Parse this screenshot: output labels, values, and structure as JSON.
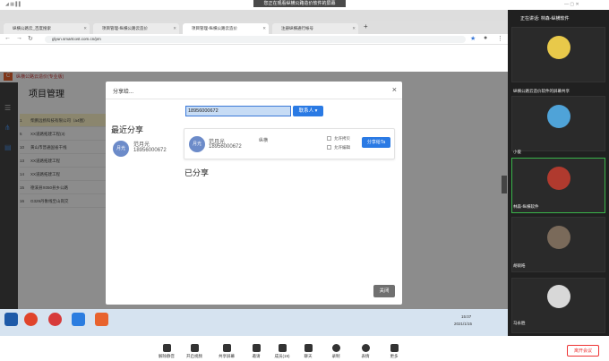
{
  "banner": {
    "text": "您正在观看纵横公路造价软件的屏幕"
  },
  "browser": {
    "tabs": [
      {
        "label": "纵横公路云_百度搜索"
      },
      {
        "label": "项目管理-纵横公路云造价"
      },
      {
        "label": "项目管理-纵横公路云造价"
      },
      {
        "label": "注册纵横通行帐号"
      }
    ],
    "url": "glyun.smartcost.com.cn/pm"
  },
  "app": {
    "brand": "纵横公路云造价(专业版)",
    "title": "项目管理",
    "rows": [
      {
        "num": "1",
        "name": "柴鹏远扬科技有限公司（a4图）"
      },
      {
        "num": "5",
        "name": "XX道路拓建工程(3)"
      },
      {
        "num": "10",
        "name": "黄山市普通国省干线"
      },
      {
        "num": "13",
        "name": "XX道路拓建工程"
      },
      {
        "num": "14",
        "name": "XX道路拓建工程"
      },
      {
        "num": "15",
        "name": "德溪县X050县乡公路"
      },
      {
        "num": "16",
        "name": "G329丹象线至山岗交"
      }
    ]
  },
  "modal": {
    "title": "分享给...",
    "search_value": "18956000672",
    "contact_label": "联系人",
    "recent_title": "最近分享",
    "recent_avatar": "月光",
    "recent_name": "范月光",
    "recent_phone": "18956000672",
    "card_avatar": "月光",
    "card_name": "范月光",
    "card_phone": "18956000672",
    "card_company": "纵横",
    "allow_copy": "允许拷贝",
    "allow_edit": "允许编辑",
    "share_to": "分享给Ta",
    "shared_title": "已分享",
    "close": "关闭"
  },
  "taskbar": {
    "time": "15:07",
    "date": "2021/1/15"
  },
  "right_panel": {
    "speaking": "正在讲话: 林森-纵横软件",
    "tiles": [
      {
        "caption": "纵横公路云造价软件的屏幕共享"
      },
      {
        "caption": "小俊"
      },
      {
        "caption": "林森-纵横软件"
      },
      {
        "caption": "胡硕皓"
      },
      {
        "caption": "马永胜"
      }
    ]
  },
  "bottom_bar": {
    "tools": [
      "解除静音",
      "开启视频",
      "共享屏幕",
      "邀请",
      "成员(19)",
      "聊天",
      "录制",
      "表情",
      "更多"
    ],
    "end_meeting": "离开会议"
  }
}
